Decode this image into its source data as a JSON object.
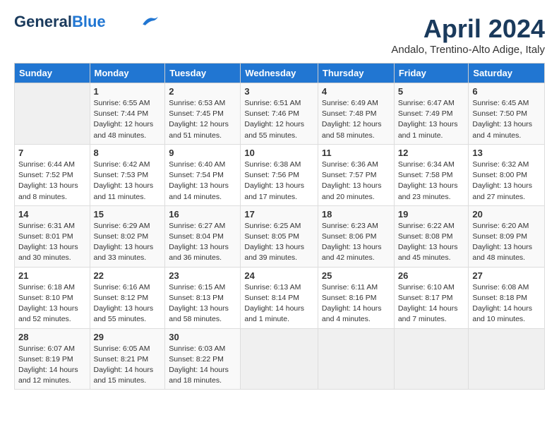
{
  "header": {
    "logo_line1": "General",
    "logo_line2": "Blue",
    "month_title": "April 2024",
    "location": "Andalo, Trentino-Alto Adige, Italy"
  },
  "weekdays": [
    "Sunday",
    "Monday",
    "Tuesday",
    "Wednesday",
    "Thursday",
    "Friday",
    "Saturday"
  ],
  "weeks": [
    [
      {
        "day": "",
        "info": ""
      },
      {
        "day": "1",
        "info": "Sunrise: 6:55 AM\nSunset: 7:44 PM\nDaylight: 12 hours\nand 48 minutes."
      },
      {
        "day": "2",
        "info": "Sunrise: 6:53 AM\nSunset: 7:45 PM\nDaylight: 12 hours\nand 51 minutes."
      },
      {
        "day": "3",
        "info": "Sunrise: 6:51 AM\nSunset: 7:46 PM\nDaylight: 12 hours\nand 55 minutes."
      },
      {
        "day": "4",
        "info": "Sunrise: 6:49 AM\nSunset: 7:48 PM\nDaylight: 12 hours\nand 58 minutes."
      },
      {
        "day": "5",
        "info": "Sunrise: 6:47 AM\nSunset: 7:49 PM\nDaylight: 13 hours\nand 1 minute."
      },
      {
        "day": "6",
        "info": "Sunrise: 6:45 AM\nSunset: 7:50 PM\nDaylight: 13 hours\nand 4 minutes."
      }
    ],
    [
      {
        "day": "7",
        "info": "Sunrise: 6:44 AM\nSunset: 7:52 PM\nDaylight: 13 hours\nand 8 minutes."
      },
      {
        "day": "8",
        "info": "Sunrise: 6:42 AM\nSunset: 7:53 PM\nDaylight: 13 hours\nand 11 minutes."
      },
      {
        "day": "9",
        "info": "Sunrise: 6:40 AM\nSunset: 7:54 PM\nDaylight: 13 hours\nand 14 minutes."
      },
      {
        "day": "10",
        "info": "Sunrise: 6:38 AM\nSunset: 7:56 PM\nDaylight: 13 hours\nand 17 minutes."
      },
      {
        "day": "11",
        "info": "Sunrise: 6:36 AM\nSunset: 7:57 PM\nDaylight: 13 hours\nand 20 minutes."
      },
      {
        "day": "12",
        "info": "Sunrise: 6:34 AM\nSunset: 7:58 PM\nDaylight: 13 hours\nand 23 minutes."
      },
      {
        "day": "13",
        "info": "Sunrise: 6:32 AM\nSunset: 8:00 PM\nDaylight: 13 hours\nand 27 minutes."
      }
    ],
    [
      {
        "day": "14",
        "info": "Sunrise: 6:31 AM\nSunset: 8:01 PM\nDaylight: 13 hours\nand 30 minutes."
      },
      {
        "day": "15",
        "info": "Sunrise: 6:29 AM\nSunset: 8:02 PM\nDaylight: 13 hours\nand 33 minutes."
      },
      {
        "day": "16",
        "info": "Sunrise: 6:27 AM\nSunset: 8:04 PM\nDaylight: 13 hours\nand 36 minutes."
      },
      {
        "day": "17",
        "info": "Sunrise: 6:25 AM\nSunset: 8:05 PM\nDaylight: 13 hours\nand 39 minutes."
      },
      {
        "day": "18",
        "info": "Sunrise: 6:23 AM\nSunset: 8:06 PM\nDaylight: 13 hours\nand 42 minutes."
      },
      {
        "day": "19",
        "info": "Sunrise: 6:22 AM\nSunset: 8:08 PM\nDaylight: 13 hours\nand 45 minutes."
      },
      {
        "day": "20",
        "info": "Sunrise: 6:20 AM\nSunset: 8:09 PM\nDaylight: 13 hours\nand 48 minutes."
      }
    ],
    [
      {
        "day": "21",
        "info": "Sunrise: 6:18 AM\nSunset: 8:10 PM\nDaylight: 13 hours\nand 52 minutes."
      },
      {
        "day": "22",
        "info": "Sunrise: 6:16 AM\nSunset: 8:12 PM\nDaylight: 13 hours\nand 55 minutes."
      },
      {
        "day": "23",
        "info": "Sunrise: 6:15 AM\nSunset: 8:13 PM\nDaylight: 13 hours\nand 58 minutes."
      },
      {
        "day": "24",
        "info": "Sunrise: 6:13 AM\nSunset: 8:14 PM\nDaylight: 14 hours\nand 1 minute."
      },
      {
        "day": "25",
        "info": "Sunrise: 6:11 AM\nSunset: 8:16 PM\nDaylight: 14 hours\nand 4 minutes."
      },
      {
        "day": "26",
        "info": "Sunrise: 6:10 AM\nSunset: 8:17 PM\nDaylight: 14 hours\nand 7 minutes."
      },
      {
        "day": "27",
        "info": "Sunrise: 6:08 AM\nSunset: 8:18 PM\nDaylight: 14 hours\nand 10 minutes."
      }
    ],
    [
      {
        "day": "28",
        "info": "Sunrise: 6:07 AM\nSunset: 8:19 PM\nDaylight: 14 hours\nand 12 minutes."
      },
      {
        "day": "29",
        "info": "Sunrise: 6:05 AM\nSunset: 8:21 PM\nDaylight: 14 hours\nand 15 minutes."
      },
      {
        "day": "30",
        "info": "Sunrise: 6:03 AM\nSunset: 8:22 PM\nDaylight: 14 hours\nand 18 minutes."
      },
      {
        "day": "",
        "info": ""
      },
      {
        "day": "",
        "info": ""
      },
      {
        "day": "",
        "info": ""
      },
      {
        "day": "",
        "info": ""
      }
    ]
  ]
}
